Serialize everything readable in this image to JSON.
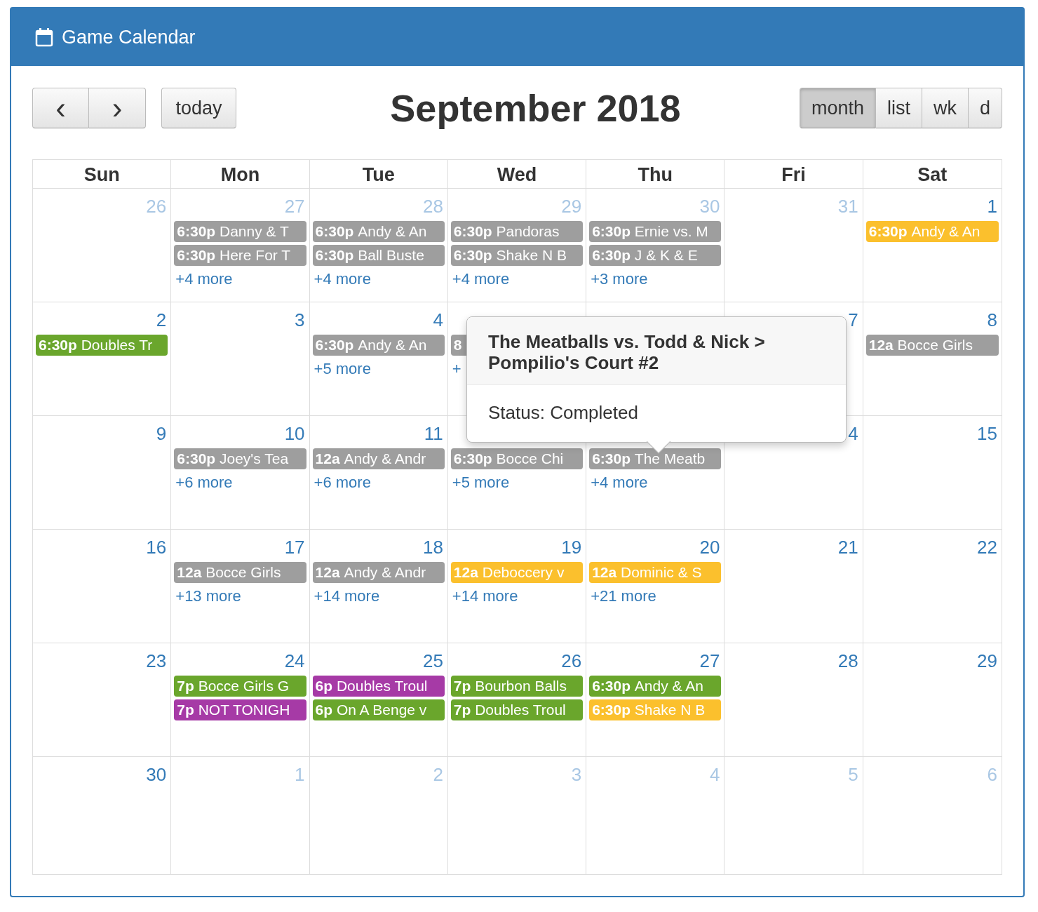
{
  "panel": {
    "title": "Game Calendar"
  },
  "toolbar": {
    "prev": "‹",
    "next": "›",
    "today": "today",
    "title": "September 2018",
    "views": [
      {
        "label": "month",
        "selected": true
      },
      {
        "label": "list",
        "selected": false
      },
      {
        "label": "wk",
        "selected": false
      },
      {
        "label": "d",
        "selected": false
      }
    ]
  },
  "weekdays": [
    "Sun",
    "Mon",
    "Tue",
    "Wed",
    "Thu",
    "Fri",
    "Sat"
  ],
  "weeks": [
    [
      {
        "kind": "day",
        "number": "26",
        "other_month": true
      },
      {
        "kind": "day",
        "number": "27",
        "other_month": true,
        "events": [
          {
            "time": "6:30p",
            "title": "Danny & T",
            "color": "#9e9e9e"
          },
          {
            "time": "6:30p",
            "title": "Here For T",
            "color": "#9e9e9e"
          }
        ],
        "more": "+4 more"
      },
      {
        "kind": "day",
        "number": "28",
        "other_month": true,
        "events": [
          {
            "time": "6:30p",
            "title": "Andy & An",
            "color": "#9e9e9e"
          },
          {
            "time": "6:30p",
            "title": "Ball Buste",
            "color": "#9e9e9e"
          }
        ],
        "more": "+4 more"
      },
      {
        "kind": "day",
        "number": "29",
        "other_month": true,
        "events": [
          {
            "time": "6:30p",
            "title": "Pandoras",
            "color": "#9e9e9e"
          },
          {
            "time": "6:30p",
            "title": "Shake N B",
            "color": "#9e9e9e"
          }
        ],
        "more": "+4 more"
      },
      {
        "kind": "day",
        "number": "30",
        "other_month": true,
        "events": [
          {
            "time": "6:30p",
            "title": "Ernie vs. M",
            "color": "#9e9e9e"
          },
          {
            "time": "6:30p",
            "title": "J & K & E",
            "color": "#9e9e9e"
          }
        ],
        "more": "+3 more"
      },
      {
        "kind": "day",
        "number": "31",
        "other_month": true
      },
      {
        "kind": "day",
        "number": "1",
        "other_month": false,
        "events": [
          {
            "time": "6:30p",
            "title": "Andy & An",
            "color": "#fbc02d"
          }
        ]
      }
    ],
    [
      {
        "kind": "day",
        "number": "2",
        "other_month": false,
        "events": [
          {
            "time": "6:30p",
            "title": "Doubles Tr",
            "color": "#6aa62c"
          }
        ]
      },
      {
        "kind": "day",
        "number": "3",
        "other_month": false
      },
      {
        "kind": "day",
        "number": "4",
        "other_month": false,
        "events": [
          {
            "time": "6:30p",
            "title": "Andy & An",
            "color": "#9e9e9e"
          }
        ],
        "more": "+5 more"
      },
      {
        "kind": "day",
        "events": [
          {
            "time": "8",
            "color": "#9e9e9e"
          }
        ],
        "more": "+"
      },
      {
        "kind": "covered"
      },
      {
        "kind": "day",
        "number": "7",
        "other_month": false
      },
      {
        "kind": "day",
        "number": "8",
        "other_month": false,
        "events": [
          {
            "time": "12a",
            "title": "Bocce Girls",
            "color": "#9e9e9e"
          }
        ]
      }
    ],
    [
      {
        "kind": "day",
        "number": "9",
        "other_month": false
      },
      {
        "kind": "day",
        "number": "10",
        "other_month": false,
        "events": [
          {
            "time": "6:30p",
            "title": "Joey's Tea",
            "color": "#9e9e9e"
          }
        ],
        "more": "+6 more"
      },
      {
        "kind": "day",
        "number": "11",
        "other_month": false,
        "events": [
          {
            "time": "12a",
            "title": "Andy & Andr",
            "color": "#9e9e9e"
          }
        ],
        "more": "+6 more"
      },
      {
        "kind": "day",
        "events": [
          {
            "time": "6:30p",
            "title": "Bocce Chi",
            "color": "#9e9e9e"
          }
        ],
        "more": "+5 more"
      },
      {
        "kind": "day",
        "events": [
          {
            "time": "6:30p",
            "title": "The Meatb",
            "color": "#9e9e9e"
          }
        ],
        "more": "+4 more"
      },
      {
        "kind": "day",
        "number": "4",
        "other_month": false
      },
      {
        "kind": "day",
        "number": "15",
        "other_month": false
      }
    ],
    [
      {
        "kind": "day",
        "number": "16",
        "other_month": false
      },
      {
        "kind": "day",
        "number": "17",
        "other_month": false,
        "events": [
          {
            "time": "12a",
            "title": "Bocce Girls",
            "color": "#9e9e9e"
          }
        ],
        "more": "+13 more"
      },
      {
        "kind": "day",
        "number": "18",
        "other_month": false,
        "events": [
          {
            "time": "12a",
            "title": "Andy & Andr",
            "color": "#9e9e9e"
          }
        ],
        "more": "+14 more"
      },
      {
        "kind": "day",
        "number": "19",
        "other_month": false,
        "events": [
          {
            "time": "12a",
            "title": "Deboccery v",
            "color": "#fbc02d"
          }
        ],
        "more": "+14 more"
      },
      {
        "kind": "day",
        "number": "20",
        "other_month": false,
        "events": [
          {
            "time": "12a",
            "title": "Dominic & S",
            "color": "#fbc02d"
          }
        ],
        "more": "+21 more"
      },
      {
        "kind": "day",
        "number": "21",
        "other_month": false
      },
      {
        "kind": "day",
        "number": "22",
        "other_month": false
      }
    ],
    [
      {
        "kind": "day",
        "number": "23",
        "other_month": false
      },
      {
        "kind": "day",
        "number": "24",
        "other_month": false,
        "events": [
          {
            "time": "7p",
            "title": "Bocce Girls G",
            "color": "#6aa62c"
          },
          {
            "time": "7p",
            "title": "NOT TONIGH",
            "color": "#a63aa6"
          }
        ]
      },
      {
        "kind": "day",
        "number": "25",
        "other_month": false,
        "events": [
          {
            "time": "6p",
            "title": "Doubles Troul",
            "color": "#a63aa6"
          },
          {
            "time": "6p",
            "title": "On A Benge v",
            "color": "#6aa62c"
          }
        ]
      },
      {
        "kind": "day",
        "number": "26",
        "other_month": false,
        "events": [
          {
            "time": "7p",
            "title": "Bourbon Balls",
            "color": "#6aa62c"
          },
          {
            "time": "7p",
            "title": "Doubles Troul",
            "color": "#6aa62c"
          }
        ]
      },
      {
        "kind": "day",
        "number": "27",
        "other_month": false,
        "events": [
          {
            "time": "6:30p",
            "title": "Andy & An",
            "color": "#6aa62c"
          },
          {
            "time": "6:30p",
            "title": "Shake N B",
            "color": "#fbc02d"
          }
        ]
      },
      {
        "kind": "day",
        "number": "28",
        "other_month": false
      },
      {
        "kind": "day",
        "number": "29",
        "other_month": false
      }
    ],
    [
      {
        "kind": "day",
        "number": "30",
        "other_month": false
      },
      {
        "kind": "day",
        "number": "1",
        "other_month": true
      },
      {
        "kind": "day",
        "number": "2",
        "other_month": true
      },
      {
        "kind": "day",
        "number": "3",
        "other_month": true
      },
      {
        "kind": "day",
        "number": "4",
        "other_month": true
      },
      {
        "kind": "day",
        "number": "5",
        "other_month": true
      },
      {
        "kind": "day",
        "number": "6",
        "other_month": true
      }
    ]
  ],
  "popover": {
    "title": "The Meatballs vs. Todd & Nick > Pompilio's Court #2",
    "status": "Status: Completed"
  }
}
